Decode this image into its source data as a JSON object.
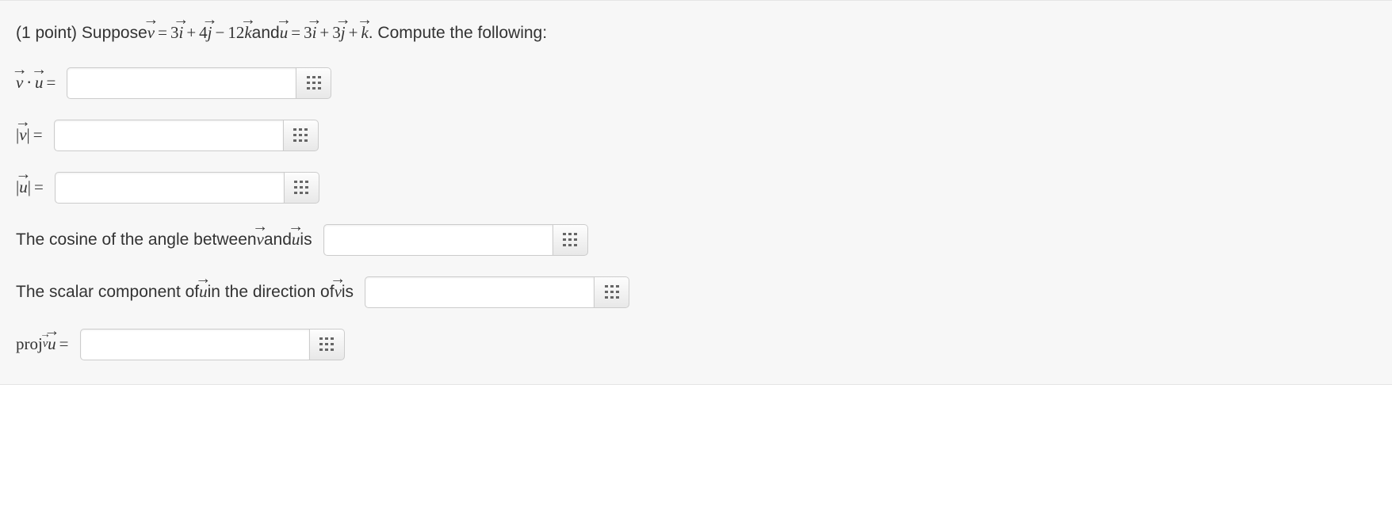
{
  "points_label": "(1 point)",
  "prompt_lead": "Suppose ",
  "vec_v_def": {
    "i": "3",
    "j": "4",
    "k": "12"
  },
  "between_word": " and ",
  "vec_u_def": {
    "i": "3",
    "j": "3",
    "k": "1"
  },
  "prompt_tail": ". Compute the following:",
  "eq": "=",
  "plus": "+",
  "minus": "−",
  "dot": "⋅",
  "bar": "|",
  "q1": {
    "value": ""
  },
  "q2": {
    "value": ""
  },
  "q3": {
    "value": ""
  },
  "q4": {
    "prefix": "The cosine of the angle between ",
    "mid": " and ",
    "suffix": " is",
    "value": ""
  },
  "q5": {
    "prefix": "The scalar component of ",
    "mid": " in the direction of ",
    "suffix": " is",
    "value": ""
  },
  "q6": {
    "label_prefix": "proj",
    "value": ""
  }
}
